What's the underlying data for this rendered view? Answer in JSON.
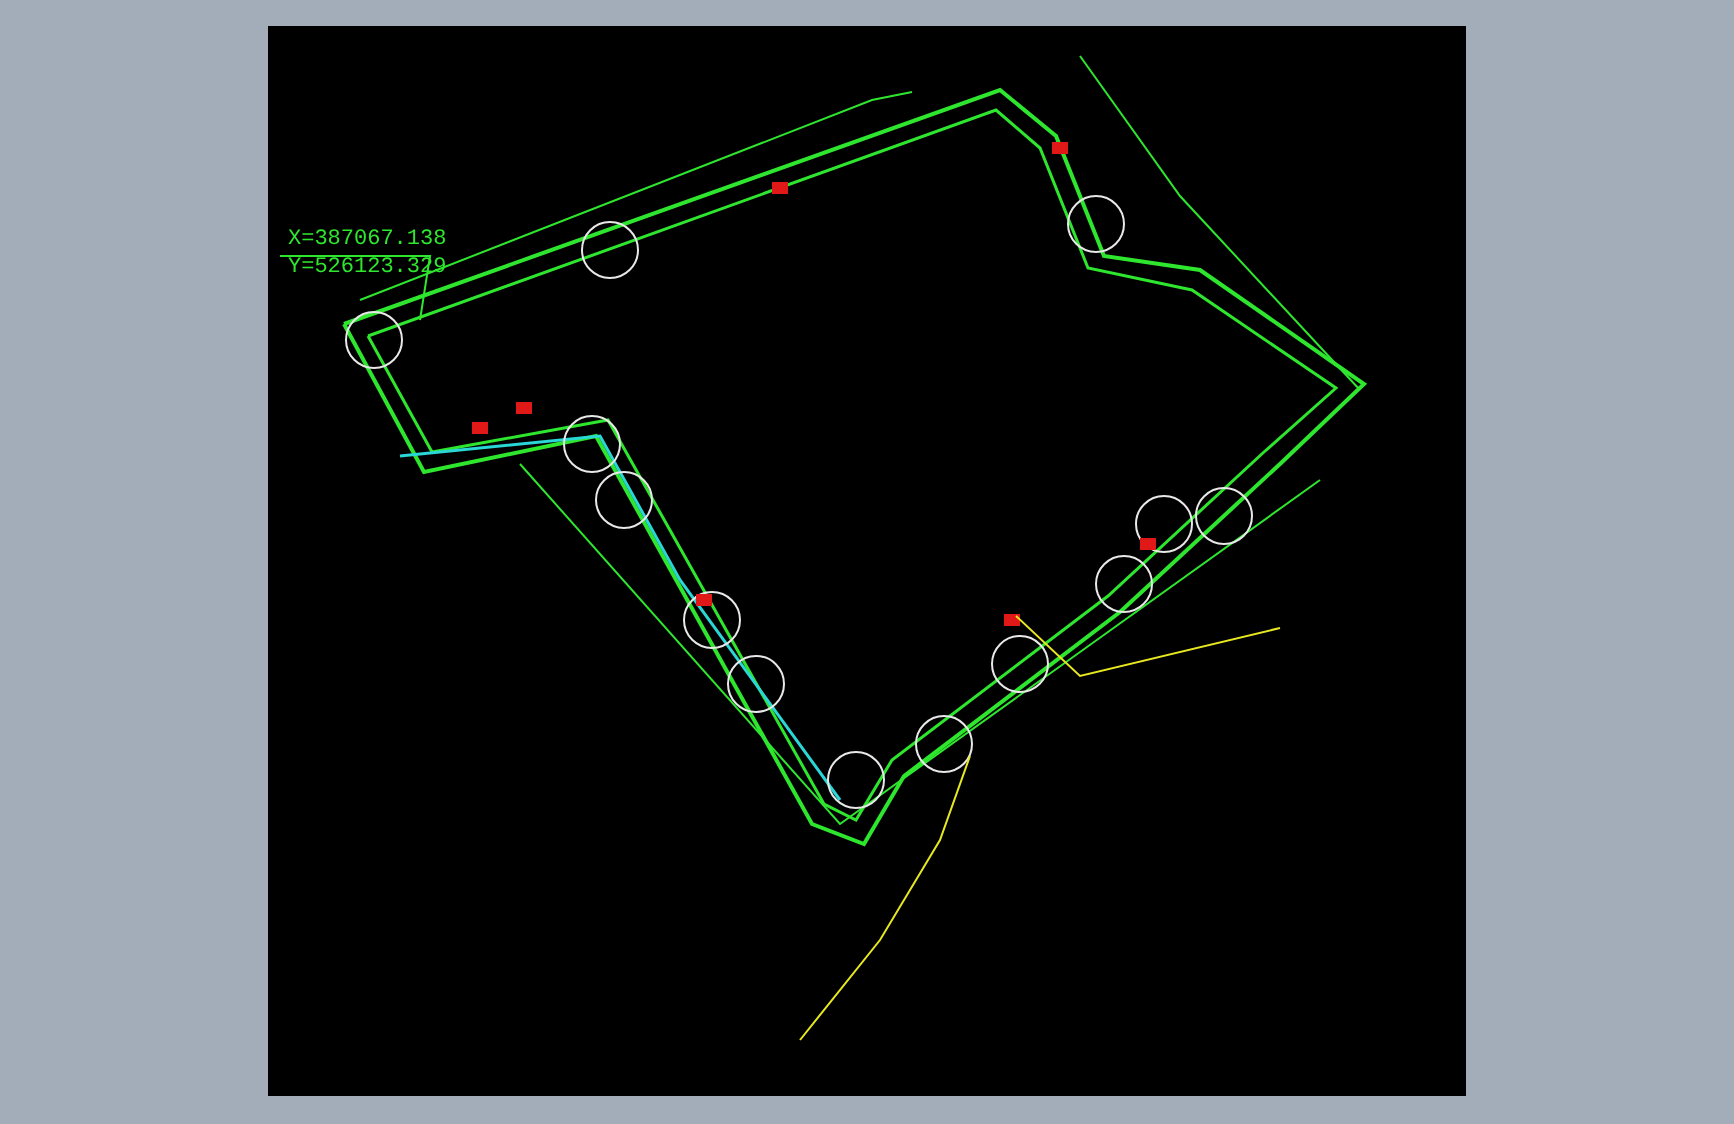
{
  "drawing": {
    "coordinate_labels": [
      "X=387067.138",
      "Y=526123.329"
    ]
  }
}
